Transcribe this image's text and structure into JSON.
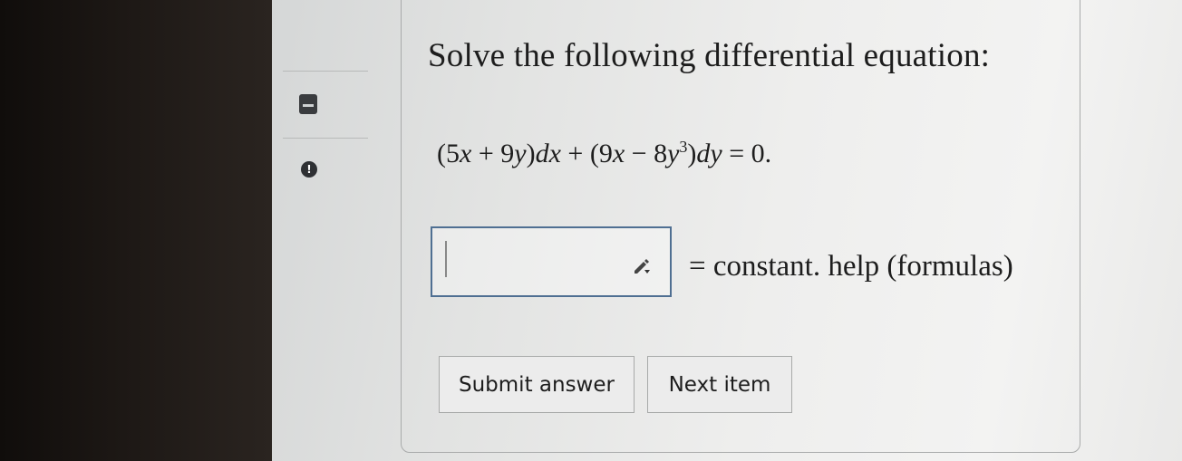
{
  "sidebar": {
    "icons": [
      "bookmark-icon",
      "info-icon"
    ],
    "info_glyph": "!"
  },
  "problem": {
    "title": "Solve the following differential equation:",
    "equation": "(5x + 9y)dx + (9x − 8y³)dy = 0."
  },
  "answer": {
    "value": "",
    "suffix": "= constant.",
    "help_label": "help (formulas)"
  },
  "actions": {
    "submit_label": "Submit answer",
    "next_label": "Next item"
  },
  "colors": {
    "input_border": "#4f6f92",
    "text": "#1d1d1d"
  }
}
